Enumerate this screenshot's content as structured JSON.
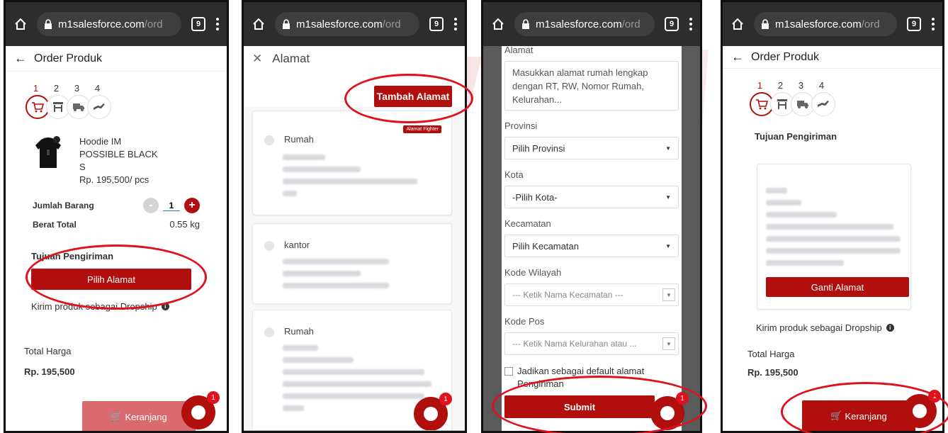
{
  "colors": {
    "brand": "#b10e0e",
    "annotation": "#e0101c",
    "statusbar": "#2d2d2d"
  },
  "browser": {
    "url_main": "m1salesforce.com",
    "url_dim": "/ord",
    "tab_count": "9"
  },
  "screen1": {
    "header": "Order Produk",
    "steps": [
      "1",
      "2",
      "3",
      "4"
    ],
    "product_name": "Hoodie IM POSSIBLE BLACK S",
    "product_price": "Rp. 195,500/ pcs",
    "qty_label": "Jumlah Barang",
    "qty_minus": "-",
    "qty_value": "1",
    "qty_plus": "+",
    "weight_label": "Berat Total",
    "weight_value": "0.55 kg",
    "shipping_title": "Tujuan Pengiriman",
    "choose_address": "Pilih Alamat",
    "dropship_text": "Kirim produk sebagai Dropship",
    "total_label": "Total Harga",
    "total_value": "Rp. 195,500",
    "cart_button": "Keranjang",
    "chat_badge": "1"
  },
  "screen2": {
    "header": "Alamat",
    "add_button": "Tambah Alamat",
    "badge": "Alamat Fighter",
    "addresses": [
      {
        "label": "Rumah"
      },
      {
        "label": "kantor"
      },
      {
        "label": "Rumah"
      }
    ],
    "chat_badge": "1"
  },
  "screen3": {
    "alamat_label": "Alamat",
    "alamat_placeholder": "Masukkan alamat rumah lengkap dengan RT, RW, Nomor Rumah, Kelurahan...",
    "provinsi_label": "Provinsi",
    "provinsi_value": "Pilih Provinsi",
    "kota_label": "Kota",
    "kota_value": "-Pilih Kota-",
    "kecamatan_label": "Kecamatan",
    "kecamatan_value": "Pilih Kecamatan",
    "kode_wilayah_label": "Kode Wilayah",
    "kode_wilayah_value": "--- Ketik Nama Kecamatan ---",
    "kode_pos_label": "Kode Pos",
    "kode_pos_value": "--- Ketik Nama Kelurahan atau ...",
    "default_checkbox": "Jadikan sebagai default alamat Pengiriman",
    "submit": "Submit",
    "chat_badge": "1"
  },
  "screen4": {
    "header": "Order Produk",
    "steps": [
      "1",
      "2",
      "3",
      "4"
    ],
    "shipping_title": "Tujuan Pengiriman",
    "address_label": "Rumah",
    "change_address": "Ganti Alamat",
    "dropship_text": "Kirim produk sebagai Dropship",
    "total_label": "Total Harga",
    "total_value": "Rp. 195,500",
    "cart_button": "Keranjang",
    "chat_badge": "1"
  }
}
